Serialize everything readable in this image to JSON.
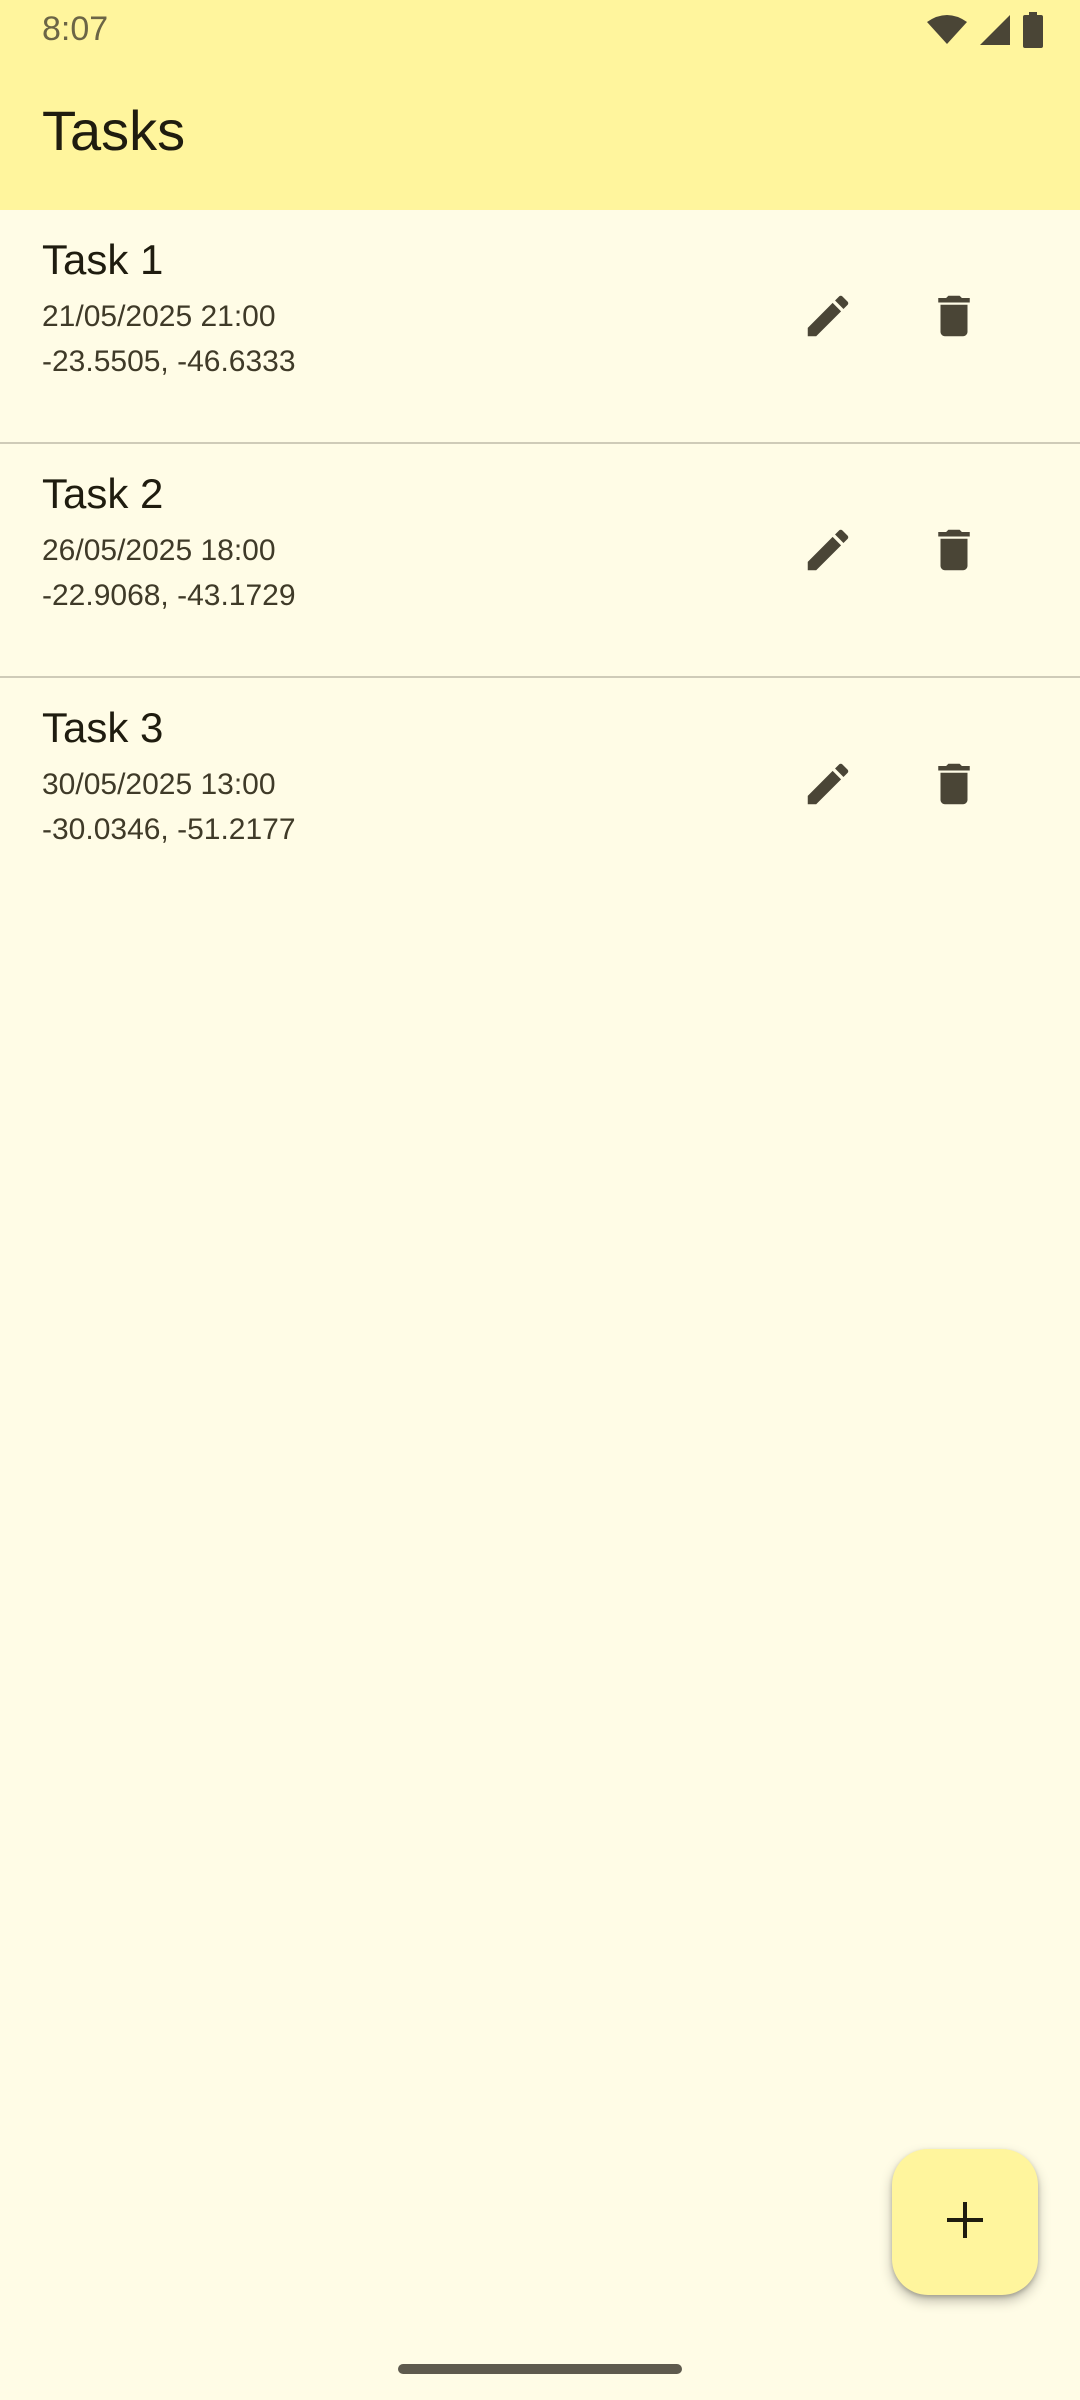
{
  "status_bar": {
    "time": "8:07",
    "icons": [
      "wifi-icon",
      "signal-icon",
      "battery-icon"
    ]
  },
  "app_bar": {
    "title": "Tasks"
  },
  "tasks": [
    {
      "title": "Task 1",
      "datetime": "21/05/2025 21:00",
      "coordinates": "-23.5505, -46.6333",
      "actions": [
        "edit-icon",
        "delete-icon"
      ]
    },
    {
      "title": "Task 2",
      "datetime": "26/05/2025 18:00",
      "coordinates": "-22.9068, -43.1729",
      "actions": [
        "edit-icon",
        "delete-icon"
      ]
    },
    {
      "title": "Task 3",
      "datetime": "30/05/2025 13:00",
      "coordinates": "-30.0346, -51.2177",
      "actions": [
        "edit-icon",
        "delete-icon"
      ]
    }
  ],
  "fab": {
    "icon": "add-icon"
  },
  "colors": {
    "app_bar": "#FFF59D",
    "background": "#FFFCE6",
    "icon": "#4A4536",
    "divider": "#CFCBB8"
  }
}
